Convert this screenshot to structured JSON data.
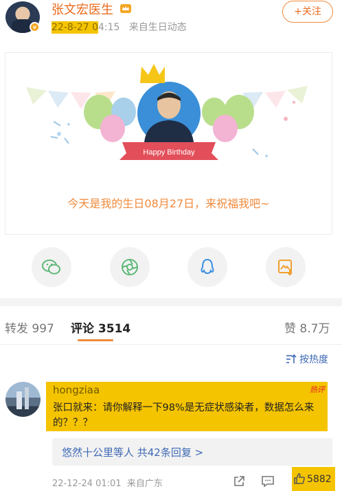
{
  "post": {
    "username": "张文宏医生",
    "date": "22-8-27 0",
    "time_rest": "4:15",
    "source": "来自生日动态",
    "follow_label": "+关注",
    "verify_mark": "v"
  },
  "card": {
    "banner_text": "Happy Birthday",
    "message": "今天是我的生日08月27日，来祝福我吧~"
  },
  "share": {
    "icons": [
      "wechat-icon",
      "moments-icon",
      "qq-icon",
      "save-image-icon"
    ]
  },
  "tabs": {
    "repost_label": "转发",
    "repost_count": "997",
    "comment_label": "评论",
    "comment_count": "3514",
    "like_label": "赞",
    "like_count": "8.7万"
  },
  "sort": {
    "label": "按热度"
  },
  "comment": {
    "user": "hongziaa",
    "hot_badge": "热评",
    "text": "张口就来：请你解释一下98%是无症状感染者，数据怎么来的？？？",
    "reply_summary": "悠然十公里等人  共42条回复 >",
    "time": "22-12-24 01:01",
    "location": "来自广东",
    "likes": "5882"
  },
  "colors": {
    "brand_orange": "#f08a3c",
    "link_blue": "#3f6ab5",
    "highlight_yellow": "#f5c400"
  }
}
